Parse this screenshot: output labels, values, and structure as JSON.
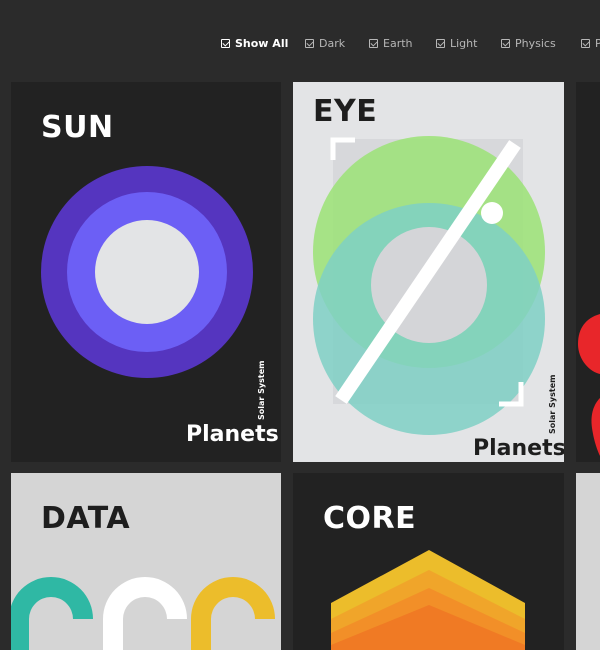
{
  "filters": [
    {
      "label": "Show All",
      "active": true
    },
    {
      "label": "Dark",
      "active": false
    },
    {
      "label": "Earth",
      "active": false
    },
    {
      "label": "Light",
      "active": false
    },
    {
      "label": "Physics",
      "active": false
    },
    {
      "label": "P",
      "active": false
    }
  ],
  "cards": {
    "sun": {
      "title": "SUN",
      "footer": "Planets",
      "side": "Solar System"
    },
    "eye": {
      "title": "EYE",
      "footer": "Planets",
      "side": "Solar System"
    },
    "data": {
      "title": "DATA"
    },
    "core": {
      "title": "CORE"
    }
  },
  "colors": {
    "page_bg": "#2b2b2b",
    "dark_card": "#222222",
    "light_card": "#e3e4e6",
    "purple_outer": "#5535bf",
    "purple_inner": "#6c5ff5",
    "green": "#9fe27b",
    "teal": "#7fd0c4",
    "red": "#e8262a",
    "yellow": "#ecbd2b",
    "orange": "#f07a24"
  }
}
